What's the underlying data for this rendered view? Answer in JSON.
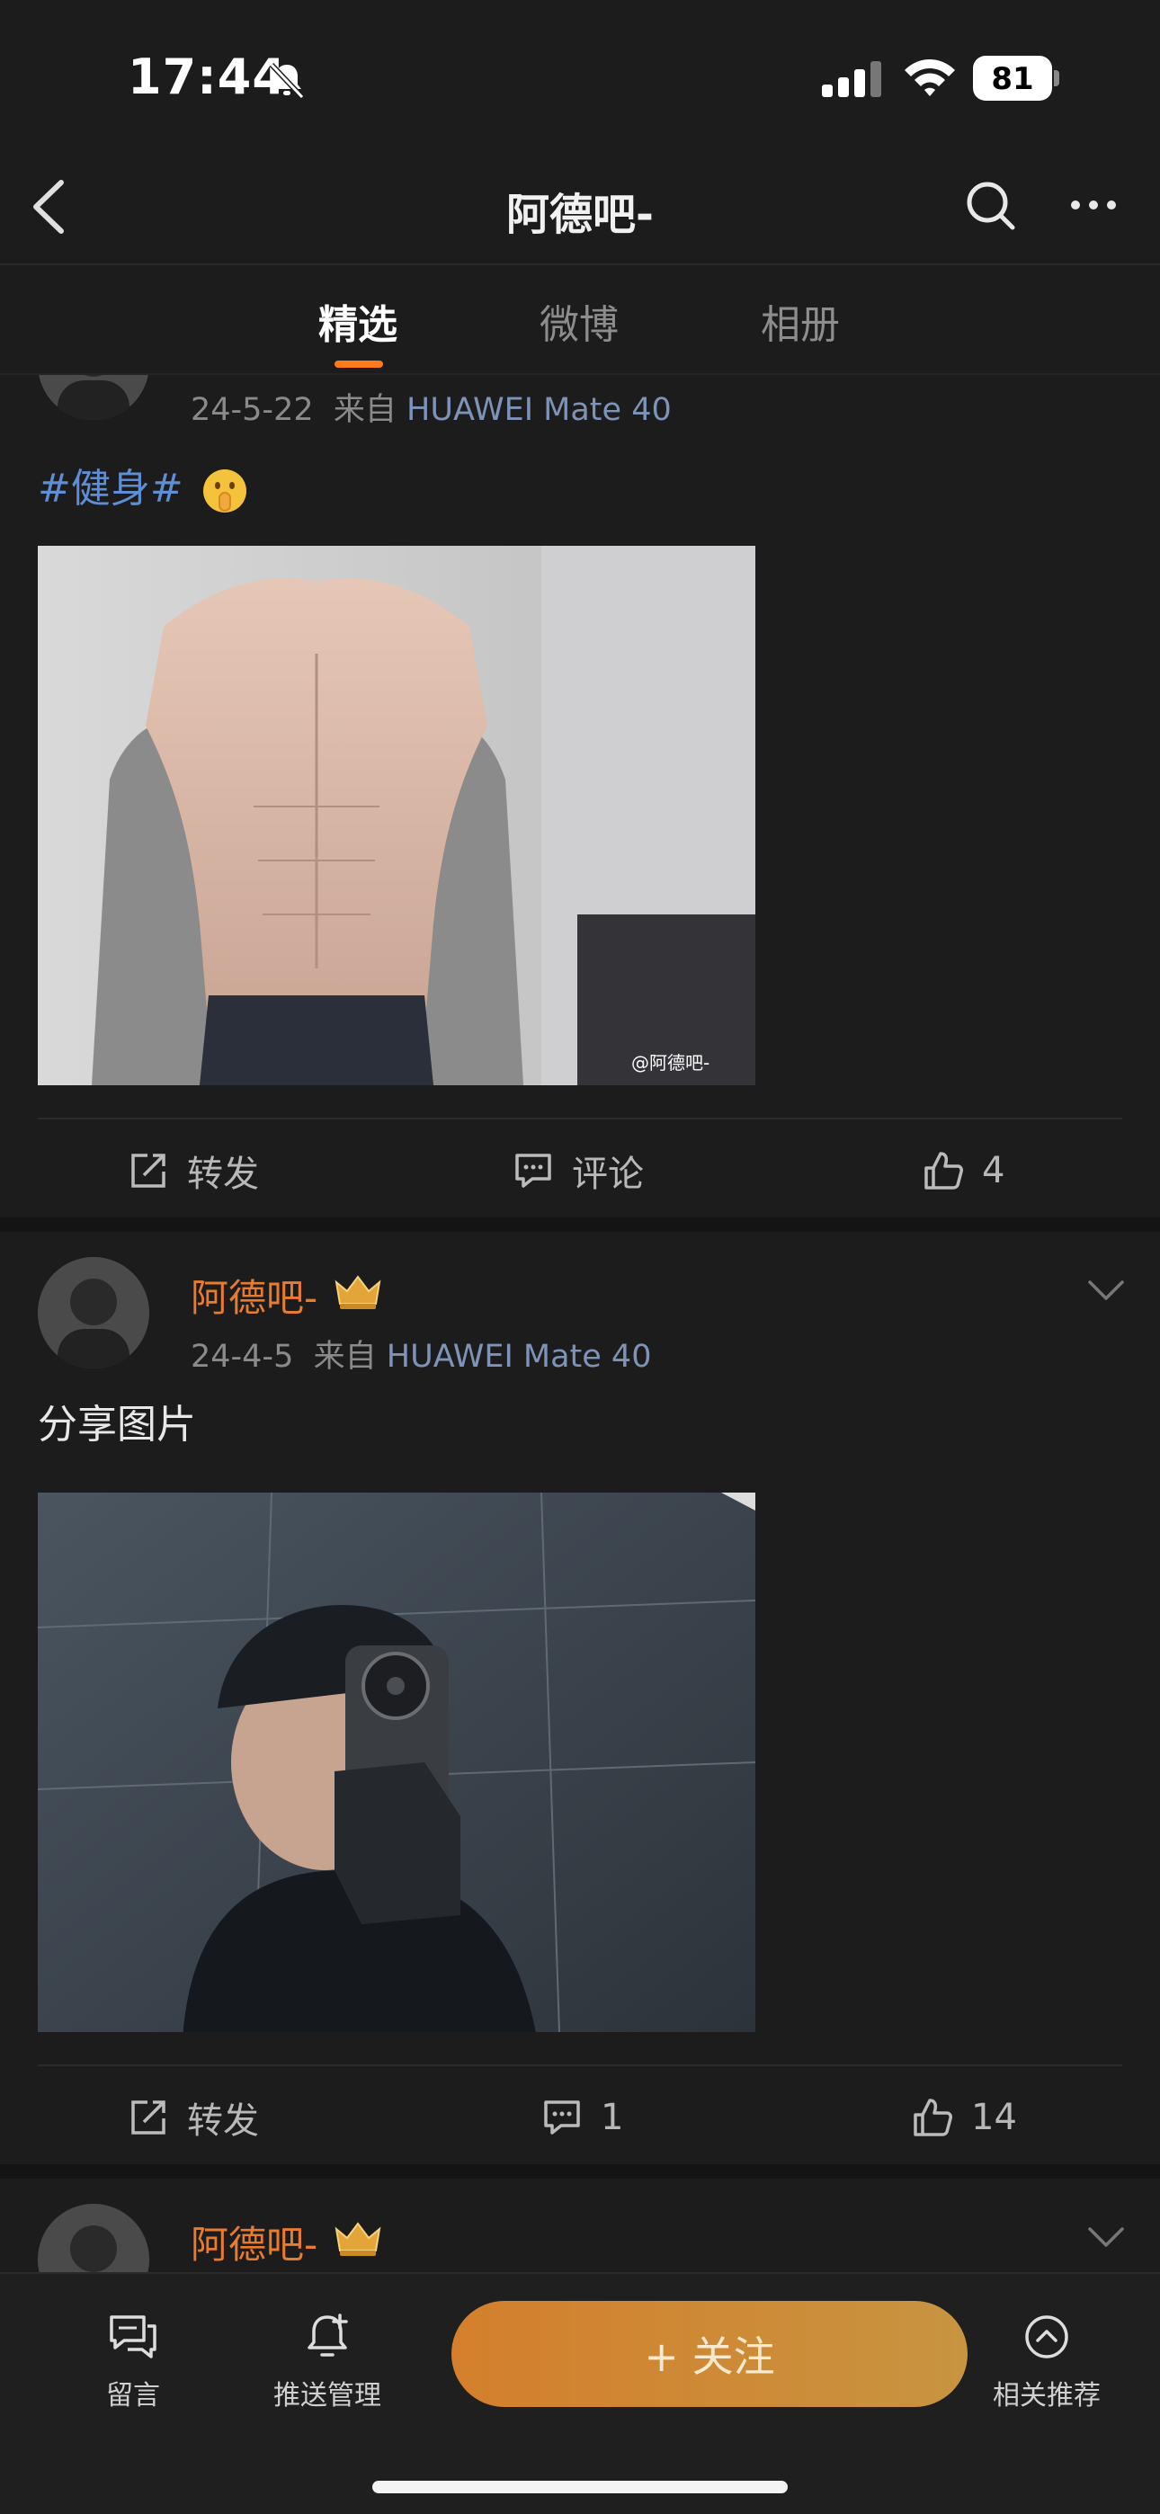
{
  "status_bar": {
    "time": "17:44",
    "battery_level": "81"
  },
  "header": {
    "title": "阿德吧-"
  },
  "tabs": [
    {
      "label": "精选",
      "active": true
    },
    {
      "label": "微博",
      "active": false
    },
    {
      "label": "相册",
      "active": false
    }
  ],
  "posts": [
    {
      "username": "",
      "date": "24-5-22",
      "source_prefix": "来自",
      "source": "HUAWEI Mate 40",
      "hashtag": "#健身#",
      "text": "",
      "image_watermark": "@阿德吧-",
      "repost_label": "转发",
      "comment_label": "评论",
      "like_count": "4"
    },
    {
      "username": "阿德吧-",
      "date": "24-4-5",
      "source_prefix": "来自",
      "source": "HUAWEI Mate 40",
      "hashtag": "",
      "text": "分享图片",
      "repost_label": "转发",
      "comment_count": "1",
      "like_count": "14"
    },
    {
      "username": "阿德吧-"
    }
  ],
  "bottom_bar": {
    "message_label": "留言",
    "push_label": "推送管理",
    "follow_label": "+ 关注",
    "related_label": "相关推荐"
  },
  "colors": {
    "background": "#1c1c1c",
    "accent_orange": "#ff7a1a",
    "username": "#e87b2f",
    "hashtag": "#5f8ed4",
    "source": "#7d93b8"
  }
}
